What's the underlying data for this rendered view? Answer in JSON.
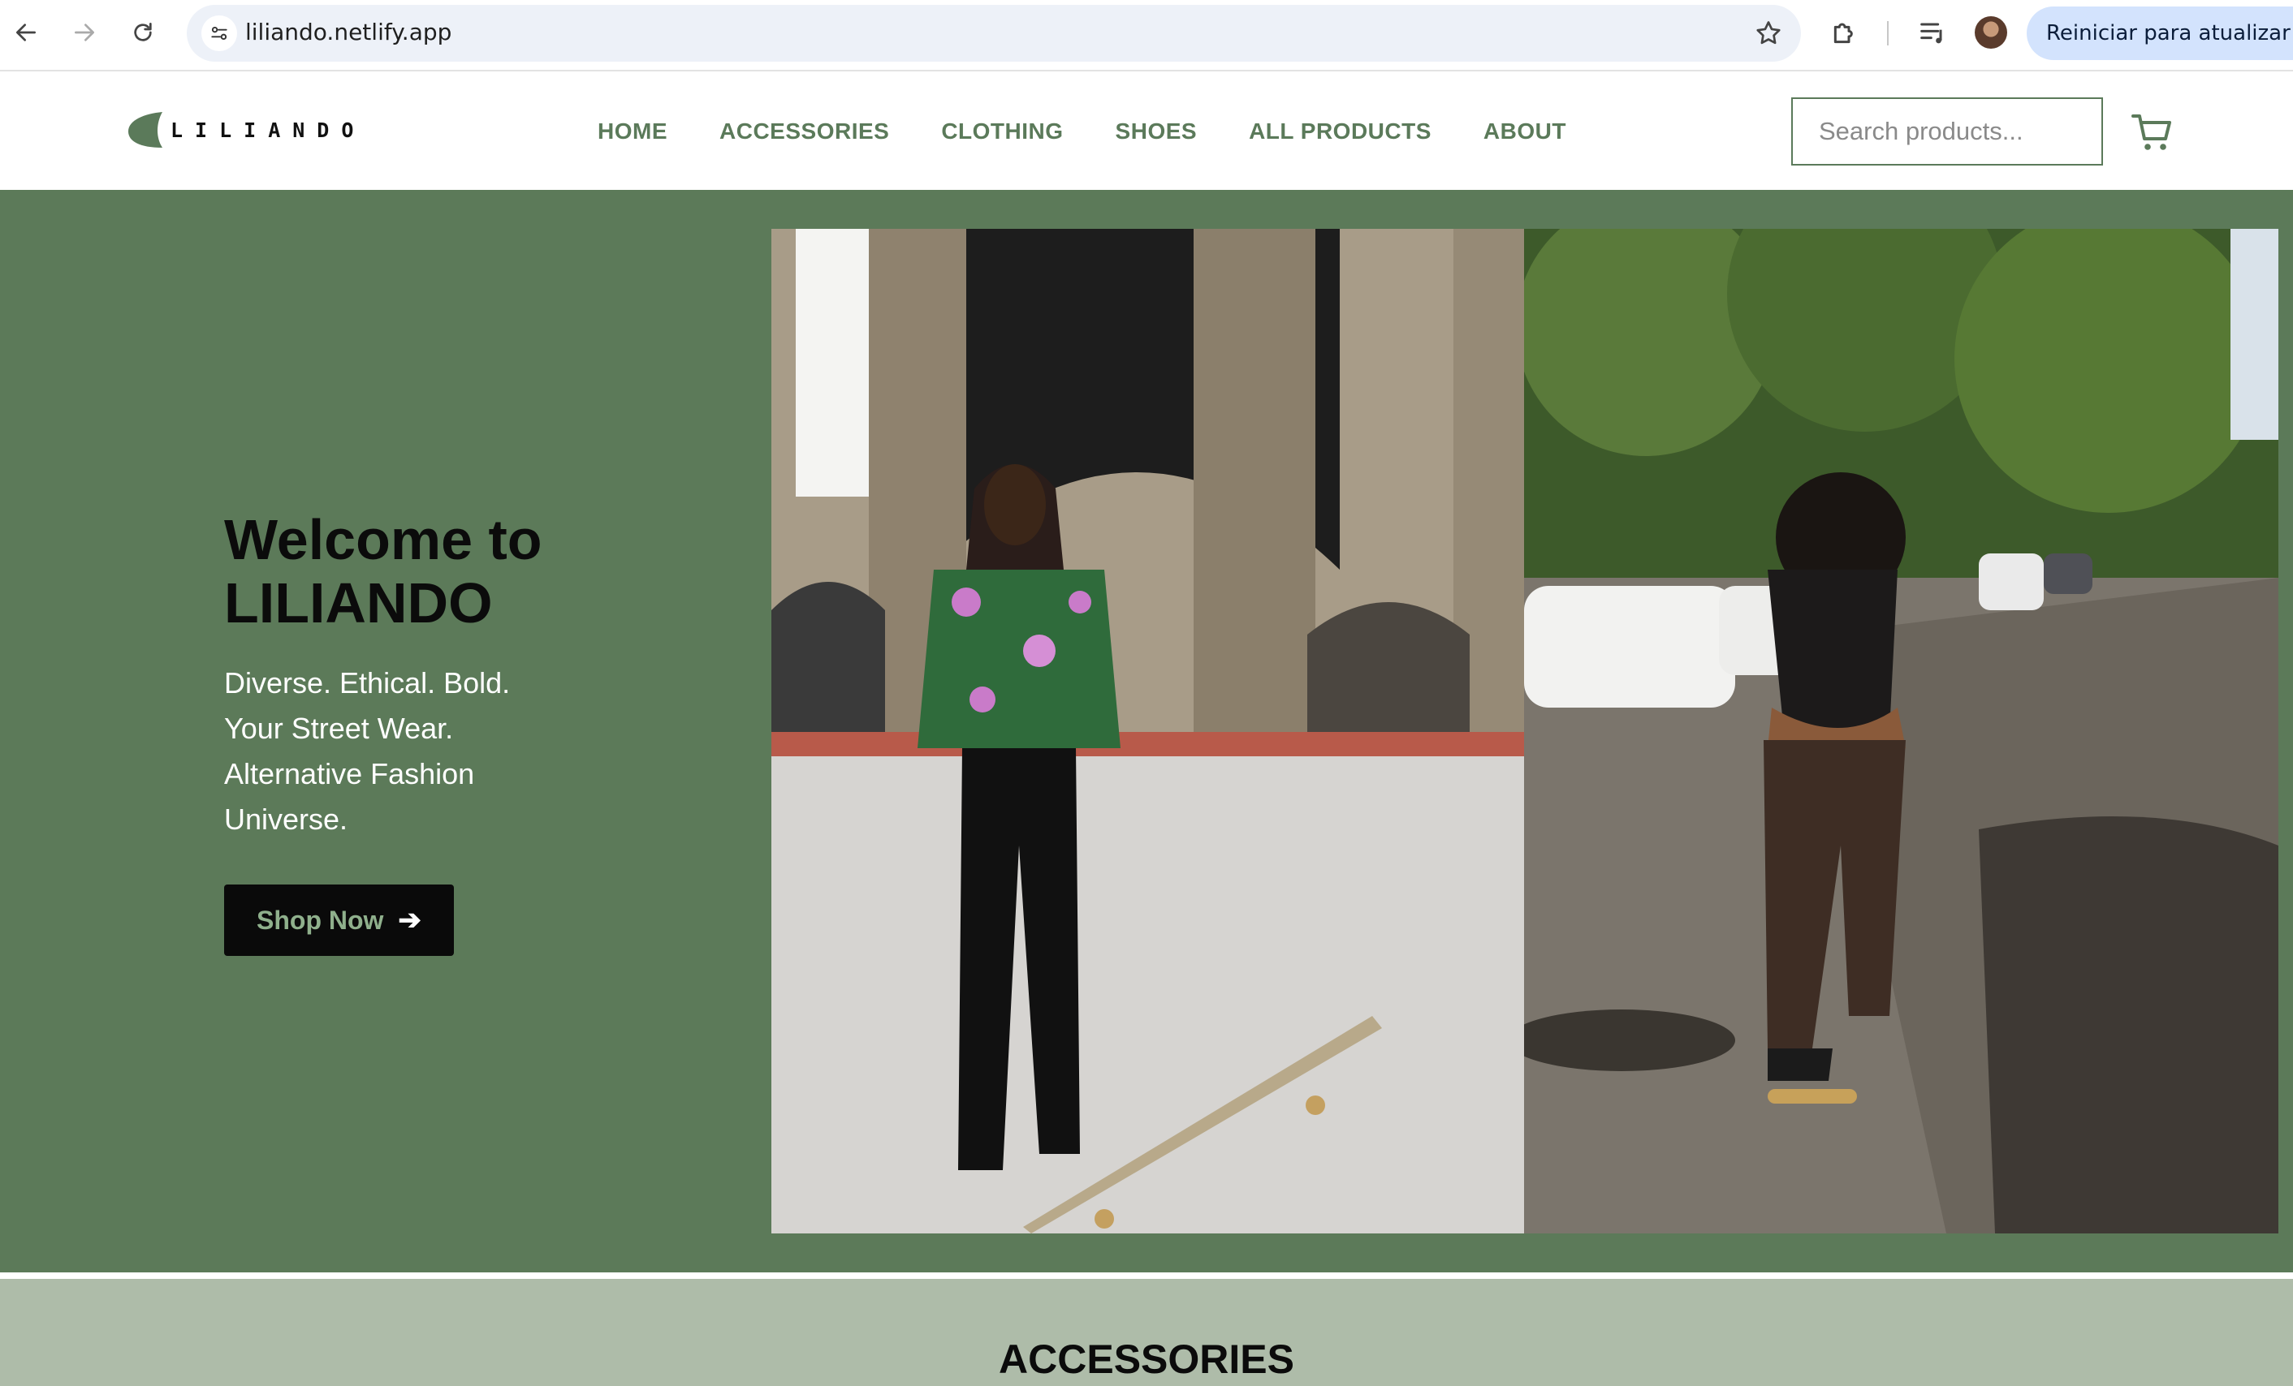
{
  "browser": {
    "url": "liliando.netlify.app",
    "relaunch_label": "Reiniciar para atualizar"
  },
  "header": {
    "logo_text": "LILIANDO",
    "nav": [
      "HOME",
      "ACCESSORIES",
      "CLOTHING",
      "SHOES",
      "ALL PRODUCTS",
      "ABOUT"
    ],
    "search_placeholder": "Search products...",
    "brand_color": "#5b7a5a"
  },
  "hero": {
    "title_line1": "Welcome to",
    "title_line2": "LILIANDO",
    "tagline": "Diverse. Ethical. Bold. Your Street Wear. Alternative Fashion Universe.",
    "cta_label": "Shop Now",
    "background": "#5c7a59"
  },
  "sections": {
    "accessories_title": "ACCESSORIES"
  }
}
